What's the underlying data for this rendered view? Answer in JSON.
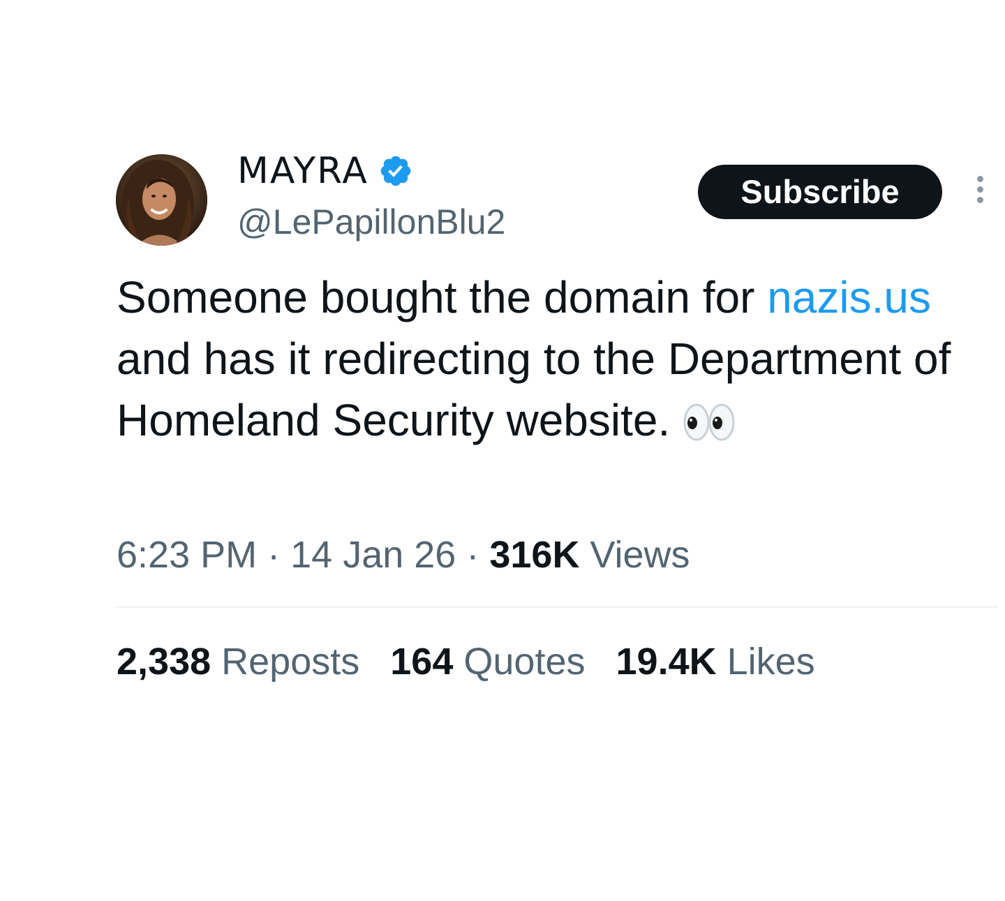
{
  "author": {
    "display_name": "MAYRA",
    "handle": "@LePapillonBlu2",
    "verified": true
  },
  "subscribe_label": "Subscribe",
  "more_icon": "more-vertical-icon",
  "tweet": {
    "text_before_link": "Someone bought the domain for ",
    "link_text": "nazis.us",
    "text_after_link": " and has it redirecting to the Department of Homeland Security website.",
    "emoji": "eyes-emoji"
  },
  "meta": {
    "time": "6:23 PM",
    "separator": "·",
    "date": "14 Jan 26",
    "views_count": "316K",
    "views_label": "Views"
  },
  "stats": {
    "reposts_count": "2,338",
    "reposts_label": "Reposts",
    "quotes_count": "164",
    "quotes_label": "Quotes",
    "likes_count": "19.4K",
    "likes_label": "Likes"
  },
  "colors": {
    "link": "#1d9bf0",
    "verified_badge": "#1d9bf0",
    "muted_text": "#536471",
    "primary_text": "#0f1419",
    "button_bg": "#0f1419"
  }
}
